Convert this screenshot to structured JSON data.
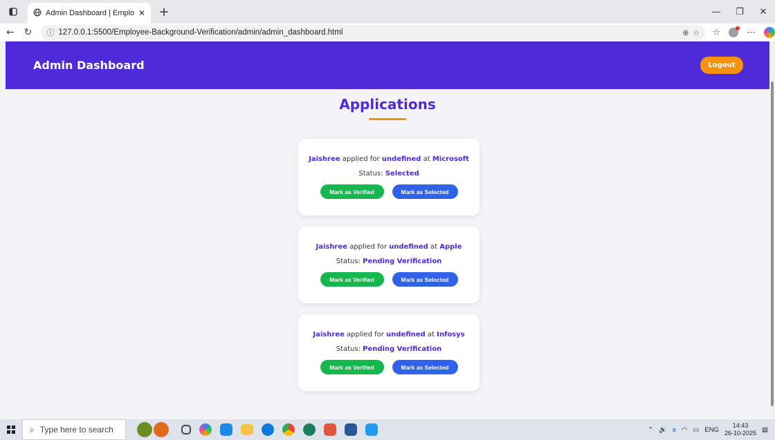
{
  "browser": {
    "tab_title": "Admin Dashboard | Employee Ba",
    "url": "127.0.0.1:5500/Employee-Background-Verification/admin/admin_dashboard.html"
  },
  "header": {
    "brand": "Admin Dashboard",
    "logout_label": "Logout"
  },
  "section": {
    "title": "Applications"
  },
  "labels": {
    "applied_for": "applied for",
    "at": "at",
    "status": "Status:",
    "verify_button": "Mark as Verified",
    "select_button": "Mark as Selected"
  },
  "applications": [
    {
      "name": "Jaishree",
      "role": "undefined",
      "company": "Microsoft",
      "status": "Selected"
    },
    {
      "name": "Jaishree",
      "role": "undefined",
      "company": "Apple",
      "status": "Pending Verification"
    },
    {
      "name": "Jaishree",
      "role": "undefined",
      "company": "Infosys",
      "status": "Pending Verification"
    }
  ],
  "taskbar": {
    "search_placeholder": "Type here to search",
    "lang": "ENG",
    "time": "14:43",
    "date": "26-10-2025"
  },
  "colors": {
    "primary": "#4f2ad8",
    "accent": "#f7920e",
    "verify": "#16b74e",
    "select": "#2f62e6"
  }
}
